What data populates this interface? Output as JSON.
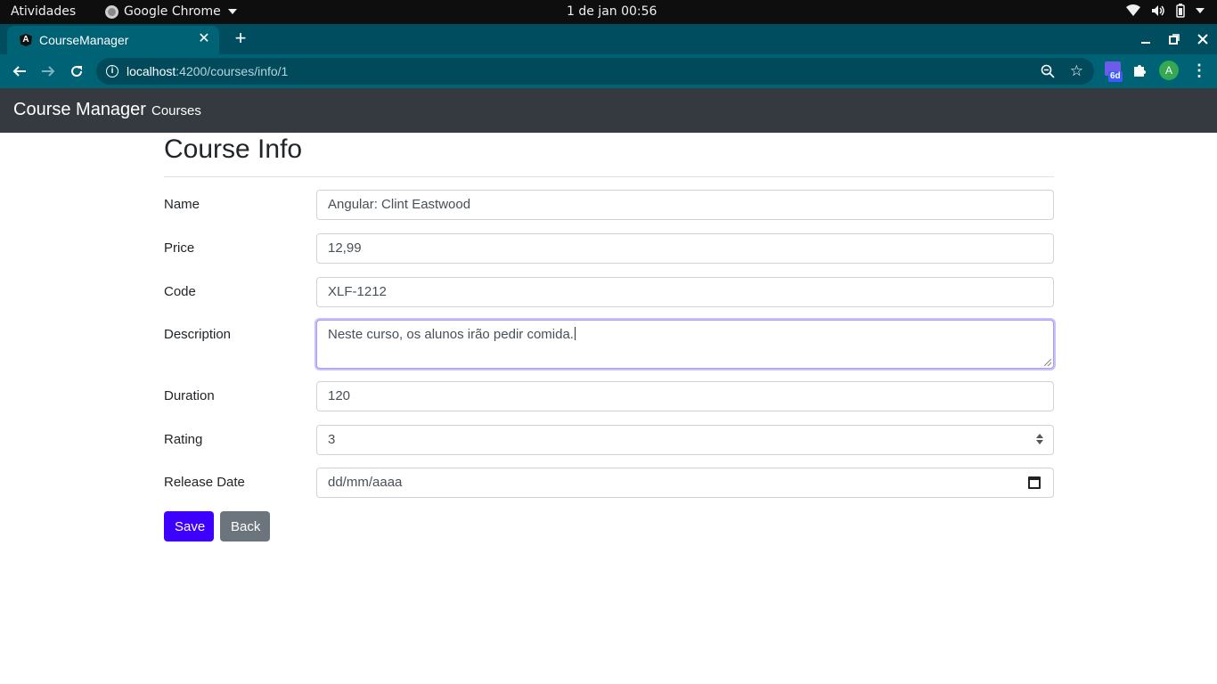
{
  "os": {
    "activities": "Atividades",
    "app_name": "Google Chrome",
    "clock": "1 de jan  00:56"
  },
  "browser": {
    "tab_title": "CourseManager",
    "tab_close": "✕",
    "new_tab": "+",
    "url_host": "localhost",
    "url_path": ":4200/courses/info/1",
    "extension_badge": "6d",
    "profile_initial": "A",
    "colors": {
      "tab_strip": "#004d60",
      "toolbar": "#006275"
    }
  },
  "navbar": {
    "brand": "Course Manager",
    "links": [
      "Courses"
    ]
  },
  "page": {
    "title": "Course Info",
    "fields": {
      "name": {
        "label": "Name",
        "value": "Angular: Clint Eastwood"
      },
      "price": {
        "label": "Price",
        "value": "12,99"
      },
      "code": {
        "label": "Code",
        "value": "XLF-1212"
      },
      "description": {
        "label": "Description",
        "value": "Neste curso, os alunos irão pedir comida."
      },
      "duration": {
        "label": "Duration",
        "value": "120"
      },
      "rating": {
        "label": "Rating",
        "value": "3"
      },
      "release_date": {
        "label": "Release Date",
        "placeholder": "dd/mm/aaaa"
      }
    },
    "buttons": {
      "save": "Save",
      "back": "Back"
    },
    "colors": {
      "save": "#3d00ff",
      "back": "#6c757d",
      "navbar": "#343a40"
    }
  }
}
